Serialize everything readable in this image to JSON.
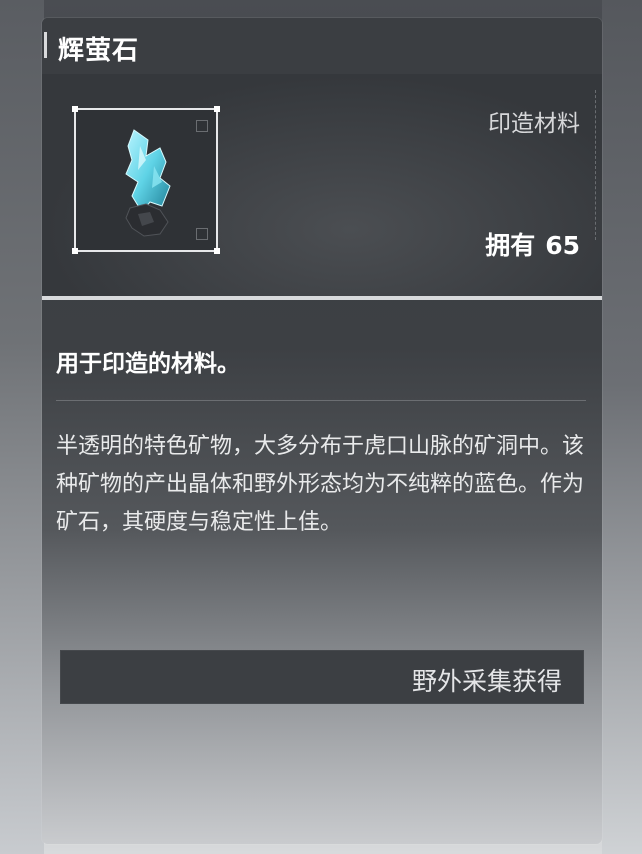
{
  "item": {
    "name": "辉萤石",
    "category": "印造材料",
    "owned_label": "拥有",
    "owned_count": "65",
    "summary": "用于印造的材料。",
    "description": "半透明的特色矿物，大多分布于虎口山脉的矿洞中。该种矿物的产出晶体和野外形态均为不纯粹的蓝色。作为矿石，其硬度与稳定性上佳。",
    "source_label": "野外采集获得",
    "icon": "blue-crystal-ore-icon"
  },
  "colors": {
    "panel_dark": "#3b3e42",
    "accent_white": "#ffffff",
    "crystal_cyan": "#5fd3e6"
  }
}
